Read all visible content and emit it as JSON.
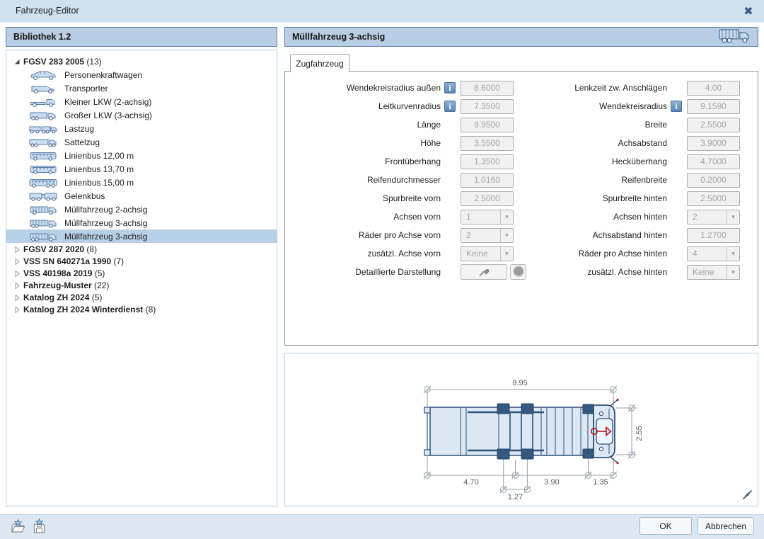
{
  "window": {
    "title": "Fahrzeug-Editor",
    "close_icon": "close-x"
  },
  "library_panel": {
    "header": "Bibliothek 1.2",
    "tree": [
      {
        "label": "FGSV 283 2005",
        "count": "(13)",
        "expanded": true,
        "children": [
          {
            "icon": "car",
            "label": "Personenkraftwagen"
          },
          {
            "icon": "van",
            "label": "Transporter"
          },
          {
            "icon": "truck-small",
            "label": "Kleiner LKW (2-achsig)"
          },
          {
            "icon": "truck-big",
            "label": "Großer LKW (3-achsig)"
          },
          {
            "icon": "truck-trailer",
            "label": "Lastzug"
          },
          {
            "icon": "semi-trailer",
            "label": "Sattelzug"
          },
          {
            "icon": "bus",
            "label": "Linienbus 12,00 m"
          },
          {
            "icon": "bus",
            "label": "Linienbus 13,70 m"
          },
          {
            "icon": "bus-long",
            "label": "Linienbus 15,00 m"
          },
          {
            "icon": "articulated-bus",
            "label": "Gelenkbus"
          },
          {
            "icon": "garbage-truck-2",
            "label": "Müllfahrzeug 2-achsig"
          },
          {
            "icon": "garbage-truck-3",
            "label": "Müllfahrzeug 3-achsig"
          },
          {
            "icon": "garbage-truck-3",
            "label": "Müllfahrzeug 3-achsig",
            "selected": true
          }
        ]
      },
      {
        "label": "FGSV 287 2020",
        "count": "(8)",
        "expanded": false
      },
      {
        "label": "VSS SN 640271a 1990",
        "count": "(7)",
        "expanded": false
      },
      {
        "label": "VSS 40198a 2019",
        "count": "(5)",
        "expanded": false
      },
      {
        "label": "Fahrzeug-Muster",
        "count": "(22)",
        "expanded": false
      },
      {
        "label": "Katalog ZH 2024",
        "count": "(5)",
        "expanded": false
      },
      {
        "label": "Katalog ZH 2024 Winterdienst",
        "count": "(8)",
        "expanded": false
      }
    ]
  },
  "vehicle_panel": {
    "header": "Müllfahrzeug 3-achsig",
    "header_icon": "garbage-truck",
    "tab": "Zugfahrzeug",
    "form": {
      "left": [
        {
          "label": "Wendekreisradius außen",
          "info": true,
          "value": "8.6000",
          "type": "input"
        },
        {
          "label": "Leitkurvenradius",
          "info": true,
          "value": "7.3500",
          "type": "input"
        },
        {
          "label": "Länge",
          "value": "9.9500",
          "type": "input"
        },
        {
          "label": "Höhe",
          "value": "3.5500",
          "type": "input"
        },
        {
          "label": "Frontüberhang",
          "value": "1.3500",
          "type": "input"
        },
        {
          "label": "Reifendurchmesser",
          "value": "1.0160",
          "type": "input"
        },
        {
          "label": "Spurbreite vorn",
          "value": "2.5000",
          "type": "input"
        },
        {
          "label": "Achsen vorn",
          "value": "1",
          "type": "select"
        },
        {
          "label": "Räder pro Achse vorn",
          "value": "2",
          "type": "select"
        },
        {
          "label": "zusätzl. Achse vorn",
          "value": "Keine",
          "type": "select"
        },
        {
          "label": "Detaillierte Darstellung",
          "type": "detail-buttons"
        }
      ],
      "right": [
        {
          "label": "Lenkzeit zw. Anschlägen",
          "value": "4.00",
          "type": "input"
        },
        {
          "label": "Wendekreisradius",
          "info": true,
          "value": "9.1590",
          "type": "input"
        },
        {
          "label": "Breite",
          "value": "2.5500",
          "type": "input"
        },
        {
          "label": "Achsabstand",
          "value": "3.9000",
          "type": "input"
        },
        {
          "label": "Hecküberhang",
          "value": "4.7000",
          "type": "input"
        },
        {
          "label": "Reifenbreite",
          "value": "0.2000",
          "type": "input"
        },
        {
          "label": "Spurbreite hinten",
          "value": "2.5000",
          "type": "input"
        },
        {
          "label": "Achsen hinten",
          "value": "2",
          "type": "select"
        },
        {
          "label": "Achsabstand hinten",
          "value": "1.2700",
          "type": "input"
        },
        {
          "label": "Räder pro Achse hinten",
          "value": "4",
          "type": "select"
        },
        {
          "label": "zusätzl. Achse hinten",
          "value": "Keine",
          "type": "select"
        }
      ]
    },
    "diagram": {
      "overall_length": "9.95",
      "width": "2.55",
      "rear_overhang": "4.70",
      "rear_axle_spacing": "1.27",
      "wheelbase": "3.90",
      "front_overhang": "1.35"
    }
  },
  "footer": {
    "ok": "OK",
    "cancel": "Abbrechen"
  },
  "colors": {
    "titlebar": "#cfe0ef",
    "panel_header": "#b9cee4",
    "panel_header_border": "#5d7fa4",
    "selection": "#b8d0e7",
    "accent_blue": "#2e5078",
    "red_marker": "#b01c1c",
    "disabled_bg": "#f1f1f1",
    "disabled_text": "#a5a5a5",
    "dim_line": "#9aa2ab"
  }
}
